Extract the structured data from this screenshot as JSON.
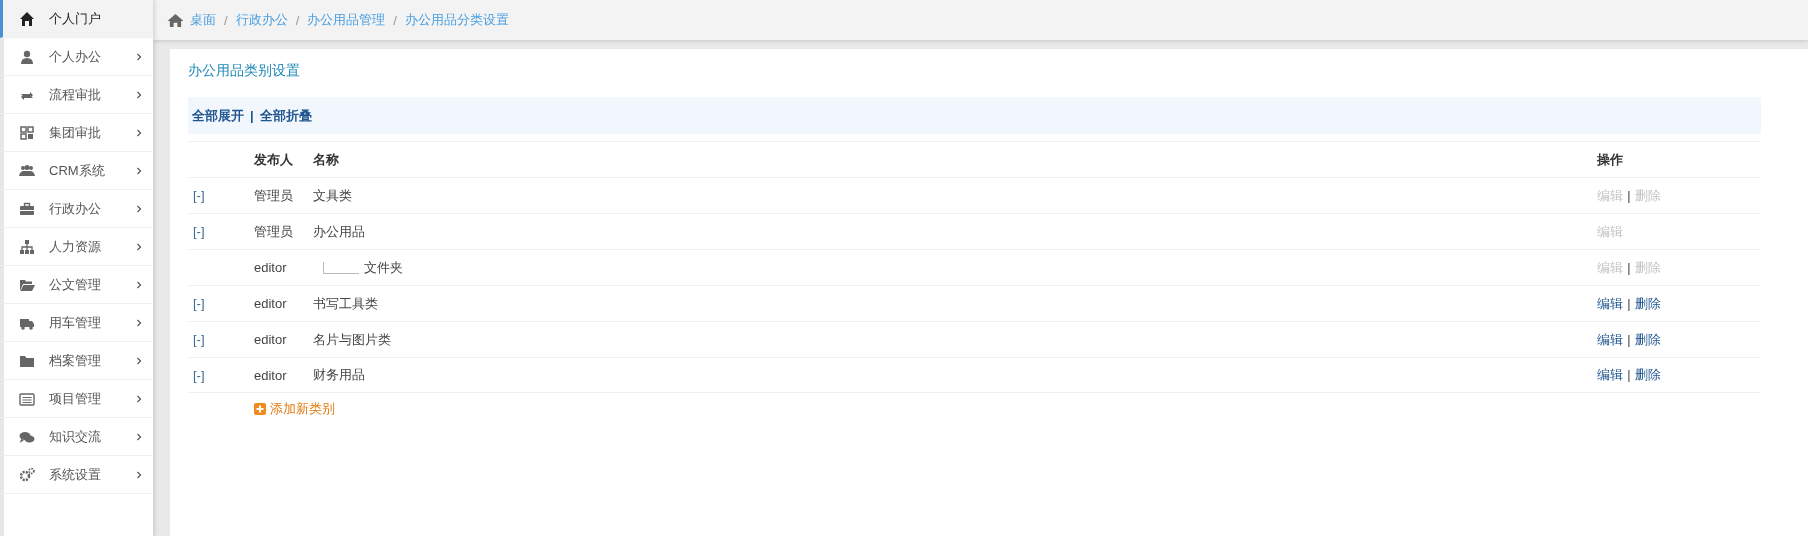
{
  "sidebar": {
    "items": [
      {
        "label": "个人门户",
        "selected": true,
        "expandable": false
      },
      {
        "label": "个人办公",
        "selected": false,
        "expandable": true
      },
      {
        "label": "流程审批",
        "selected": false,
        "expandable": true
      },
      {
        "label": "集团审批",
        "selected": false,
        "expandable": true
      },
      {
        "label": "CRM系统",
        "selected": false,
        "expandable": true
      },
      {
        "label": "行政办公",
        "selected": false,
        "expandable": true
      },
      {
        "label": "人力资源",
        "selected": false,
        "expandable": true
      },
      {
        "label": "公文管理",
        "selected": false,
        "expandable": true
      },
      {
        "label": "用车管理",
        "selected": false,
        "expandable": true
      },
      {
        "label": "档案管理",
        "selected": false,
        "expandable": true
      },
      {
        "label": "项目管理",
        "selected": false,
        "expandable": true
      },
      {
        "label": "知识交流",
        "selected": false,
        "expandable": true
      },
      {
        "label": "系统设置",
        "selected": false,
        "expandable": true
      }
    ]
  },
  "breadcrumb": {
    "separator": "/",
    "items": [
      "桌面",
      "行政办公",
      "办公用品管理",
      "办公用品分类设置"
    ]
  },
  "panel": {
    "title": "办公用品类别设置",
    "toolbar": {
      "separator": "|",
      "links": [
        "全部展开",
        "全部折叠"
      ]
    },
    "table": {
      "columns": [
        "发布人",
        "名称",
        "操作"
      ],
      "action_separator": "|",
      "rows": [
        {
          "toggle": "[-]",
          "publisher": "管理员",
          "name": "文具类",
          "actions": [
            {
              "label": "编辑",
              "disabled": true
            },
            {
              "label": "删除",
              "disabled": true
            }
          ],
          "children": []
        },
        {
          "toggle": "[-]",
          "publisher": "管理员",
          "name": "办公用品",
          "actions": [
            {
              "label": "编辑",
              "disabled": true
            }
          ],
          "children": [
            {
              "publisher": "editor",
              "name": "文件夹",
              "actions": [
                {
                  "label": "编辑",
                  "disabled": true
                },
                {
                  "label": "删除",
                  "disabled": true
                }
              ]
            }
          ]
        },
        {
          "toggle": "[-]",
          "publisher": "editor",
          "name": "书写工具类",
          "actions": [
            {
              "label": "编辑",
              "disabled": false
            },
            {
              "label": "删除",
              "disabled": false
            }
          ],
          "children": []
        },
        {
          "toggle": "[-]",
          "publisher": "editor",
          "name": "名片与图片类",
          "actions": [
            {
              "label": "编辑",
              "disabled": false
            },
            {
              "label": "删除",
              "disabled": false
            }
          ],
          "children": []
        },
        {
          "toggle": "[-]",
          "publisher": "editor",
          "name": "财务用品",
          "actions": [
            {
              "label": "编辑",
              "disabled": false
            },
            {
              "label": "删除",
              "disabled": false
            }
          ],
          "children": []
        }
      ]
    },
    "add_link": "添加新类别"
  }
}
